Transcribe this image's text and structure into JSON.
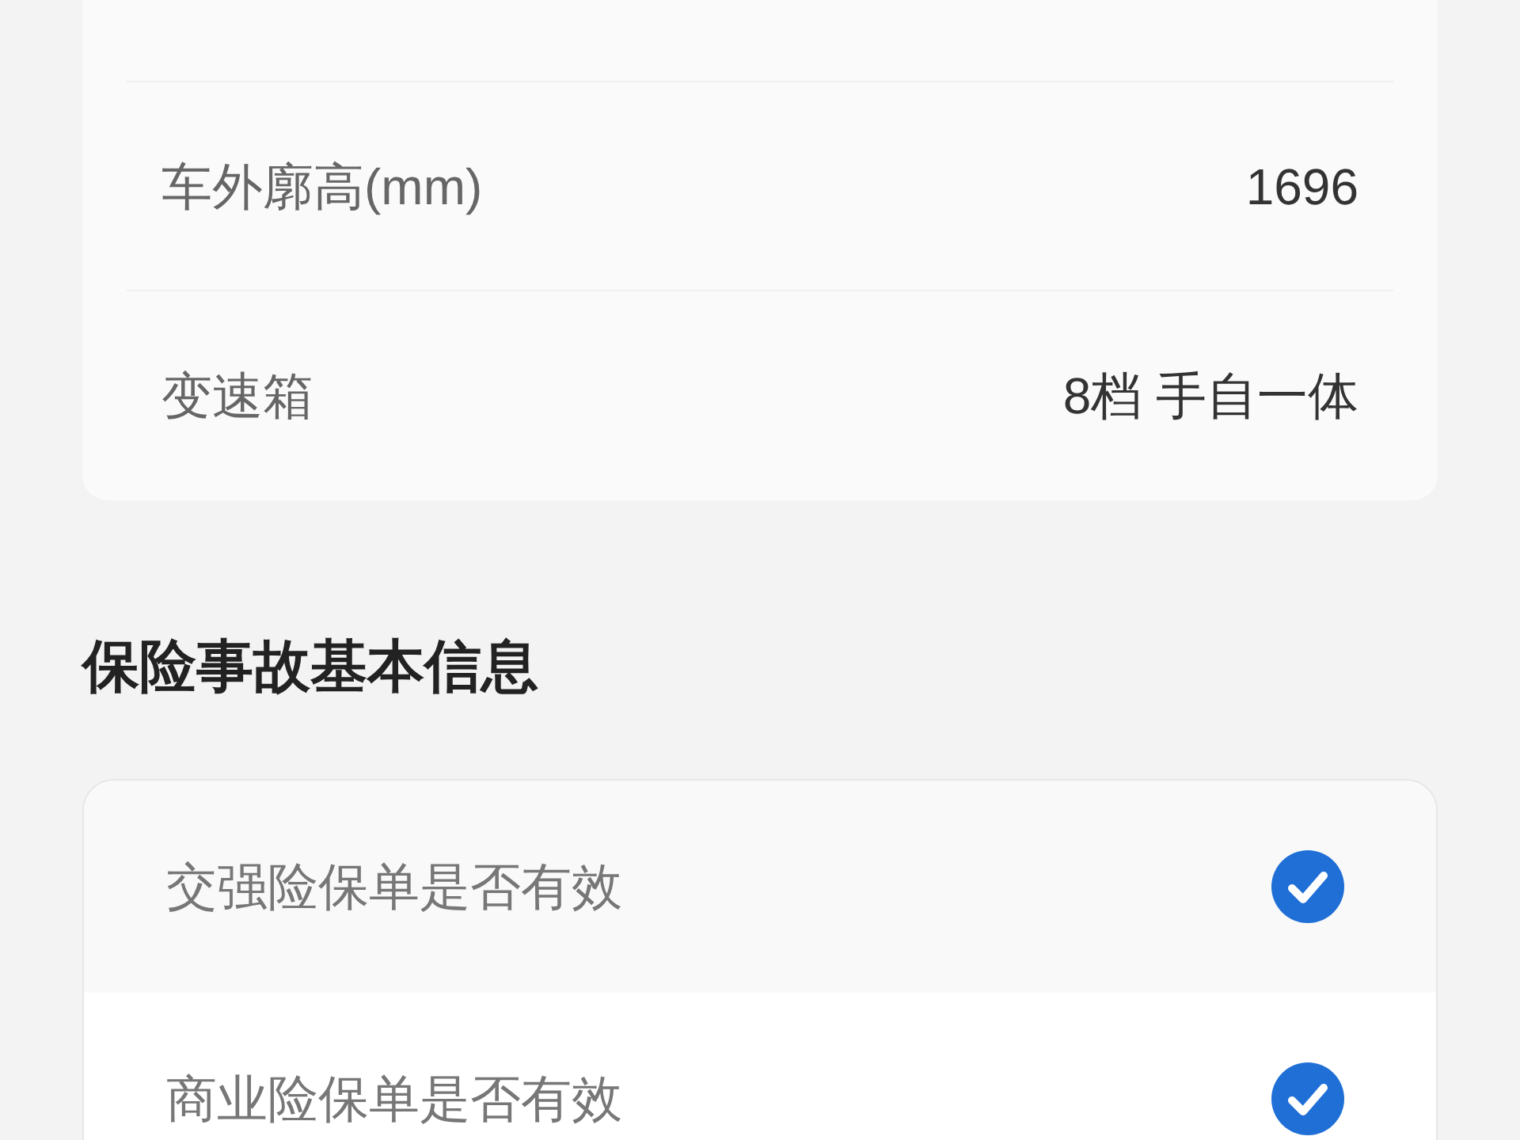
{
  "vehicle_specs": [
    {
      "label": "车外廓高(mm)",
      "value": "1696"
    },
    {
      "label": "变速箱",
      "value": "8档 手自一体"
    }
  ],
  "insurance_section": {
    "title": "保险事故基本信息",
    "items": [
      {
        "label": "交强险保单是否有效",
        "checked": true
      },
      {
        "label": "商业险保单是否有效",
        "checked": true
      }
    ]
  }
}
